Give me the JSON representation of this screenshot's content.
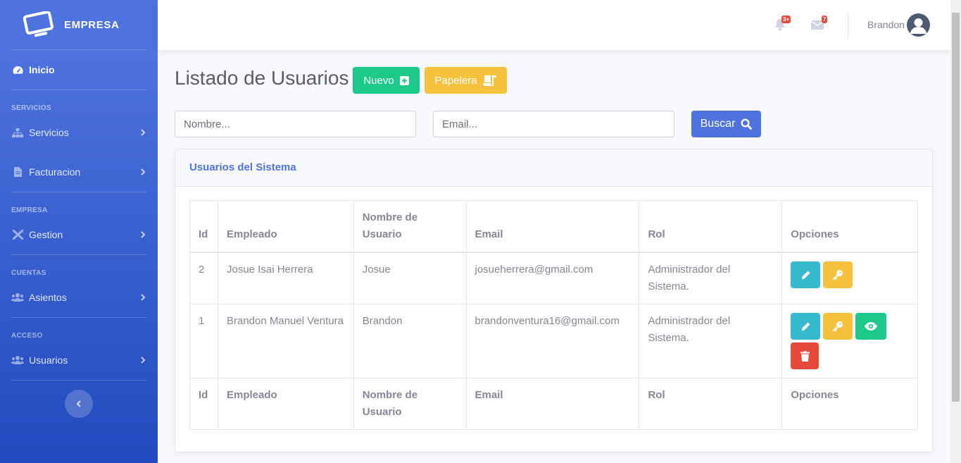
{
  "brand": {
    "name": "EMPRESA",
    "icon": "monitor-icon"
  },
  "sidebar": {
    "home": {
      "label": "Inicio",
      "icon": "tachometer-icon"
    },
    "sections": [
      {
        "heading": "SERVICIOS",
        "items": [
          {
            "label": "Servicios",
            "icon": "sitemap-icon"
          },
          {
            "label": "Facturacion",
            "icon": "file-icon"
          }
        ]
      },
      {
        "heading": "EMPRESA",
        "items": [
          {
            "label": "Gestion",
            "icon": "tools-icon"
          }
        ]
      },
      {
        "heading": "CUENTAS",
        "items": [
          {
            "label": "Asientos",
            "icon": "users-icon"
          }
        ]
      },
      {
        "heading": "ACCESO",
        "items": [
          {
            "label": "Usuarios",
            "icon": "users-icon"
          }
        ]
      }
    ]
  },
  "topbar": {
    "alerts_badge": "3+",
    "messages_badge": "7",
    "user_name": "Brandon"
  },
  "page": {
    "title": "Listado de Usuarios",
    "new_button": "Nuevo",
    "trash_button": "Papelera",
    "search_button": "Buscar",
    "name_placeholder": "Nombre...",
    "email_placeholder": "Email..."
  },
  "card": {
    "title": "Usuarios del Sistema"
  },
  "table": {
    "headers": [
      "Id",
      "Empleado",
      "Nombre de Usuario",
      "Email",
      "Rol",
      "Opciones"
    ],
    "rows": [
      {
        "id": "2",
        "empleado": "Josue Isai Herrera",
        "usuario": "Josue",
        "email": "josueherrera@gmail.com",
        "rol": "Administrador del Sistema.",
        "actions": [
          "edit",
          "key"
        ]
      },
      {
        "id": "1",
        "empleado": "Brandon Manuel Ventura",
        "usuario": "Brandon",
        "email": "brandonventura16@gmail.com",
        "rol": "Administrador del Sistema.",
        "actions": [
          "edit",
          "key",
          "view",
          "delete"
        ]
      }
    ]
  },
  "colors": {
    "primary": "#4e73df",
    "success": "#1cc88a",
    "warning": "#f6c23e",
    "info": "#36b9cc",
    "danger": "#e74a3b"
  }
}
